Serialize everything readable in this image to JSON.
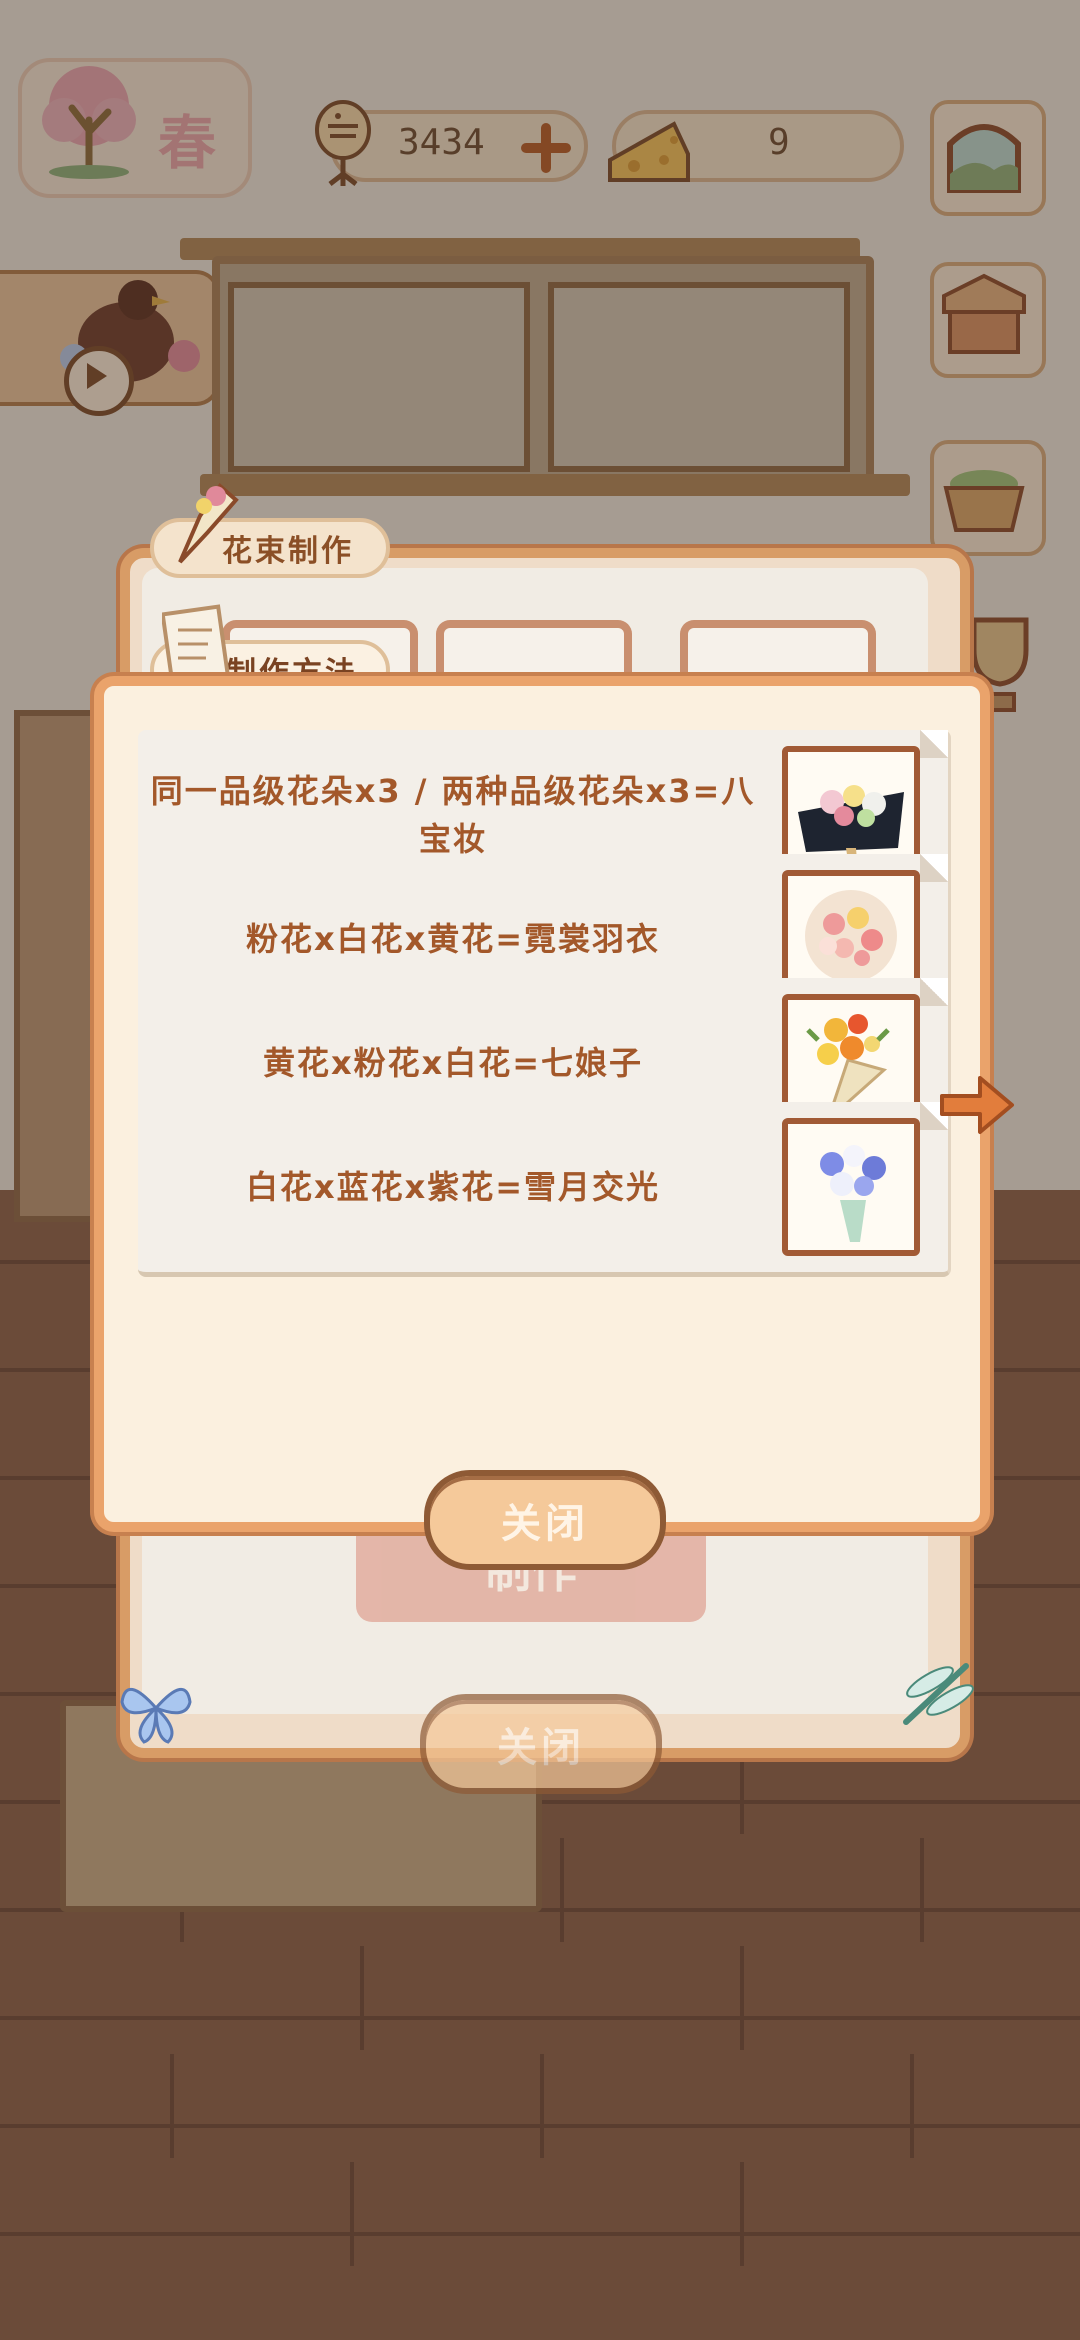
{
  "hud": {
    "season": "春",
    "fish_count": "3434",
    "cheese_count": "9"
  },
  "panel": {
    "tab_bouquet": "花束制作",
    "tab_method": "制作方法",
    "make_button": "制作",
    "close_button": "关闭"
  },
  "dialog": {
    "close_button": "关闭",
    "recipes": [
      {
        "text": "同一品级花朵x3 / 两种品级花朵x3=八宝妆",
        "thumb": "dark-wrapped-bouquet"
      },
      {
        "text": "粉花x白花x黄花=霓裳羽衣",
        "thumb": "pink-white-round-bouquet"
      },
      {
        "text": "黄花x粉花x白花=七娘子",
        "thumb": "yellow-red-cone-bouquet"
      },
      {
        "text": "白花x蓝花x紫花=雪月交光",
        "thumb": "blue-white-bouquet"
      }
    ]
  },
  "colors": {
    "accent_orange": "#eaa36b",
    "text_brown": "#a3582a",
    "button_fill": "#f5c99a"
  },
  "icons": [
    "tree-icon",
    "fish-icon",
    "plus-icon",
    "cheese-icon",
    "window-icon",
    "shop-icon",
    "basket-icon",
    "trophy-icon",
    "play-icon",
    "bouquet-icon",
    "paper-icon",
    "arrow-right-icon",
    "butterfly-icon",
    "dragonfly-icon"
  ]
}
